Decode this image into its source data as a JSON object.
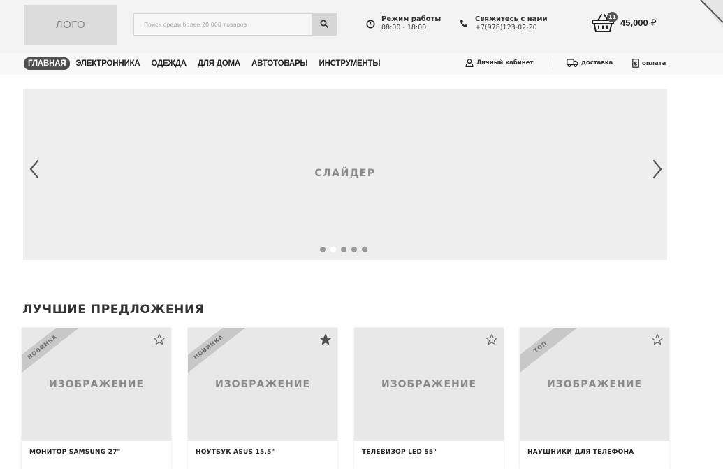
{
  "header": {
    "logo_text": "ЛОГО",
    "search": {
      "placeholder": "Поиск среди более 20 000 товаров",
      "value": ""
    },
    "hours": {
      "title": "Режим работы",
      "value": "08:00 - 18:00"
    },
    "contact": {
      "title": "Свяжитесь с нами",
      "phone": "+7(978)123-02-20"
    },
    "cart": {
      "count": "11",
      "total": "45,000",
      "currency": "₽"
    }
  },
  "nav": {
    "items": [
      {
        "label": "ГЛАВНАЯ",
        "active": true
      },
      {
        "label": "ЭЛЕКТРОННИКА"
      },
      {
        "label": "ОДЕЖДА"
      },
      {
        "label": "ДЛЯ ДОМА"
      },
      {
        "label": "АВТОТОВАРЫ"
      },
      {
        "label": "ИНСТРУМЕНТЫ"
      }
    ],
    "cabinet_label": "Личный кабинет",
    "delivery_label": "доставка",
    "payment_label": "оплата"
  },
  "slider": {
    "label": "СЛАЙДЕР",
    "dots": 5,
    "active_dot": 1
  },
  "offers": {
    "title": "ЛУЧШИЕ ПРЕДЛОЖЕНИЯ",
    "image_label": "ИЗОБРАЖЕНИЕ",
    "products": [
      {
        "name": "МОНИТОР SAMSUNG 27\"",
        "badge": "НОВИНКА",
        "favorite": false
      },
      {
        "name": "НОУТБУК ASUS 15,5\"",
        "badge": "НОВИНКА",
        "favorite": true
      },
      {
        "name": "ТЕЛЕВИЗОР LED 55\"",
        "badge": "",
        "favorite": false
      },
      {
        "name": "НАУШНИКИ ДЛЯ ТЕЛЕФОНА",
        "badge": "ТОП",
        "favorite": false
      }
    ]
  },
  "colors": {
    "accent": "#505050",
    "background": "#ffffff",
    "header_bg": "#f3f3f3",
    "placeholder_bg": "#e8e8e8"
  }
}
